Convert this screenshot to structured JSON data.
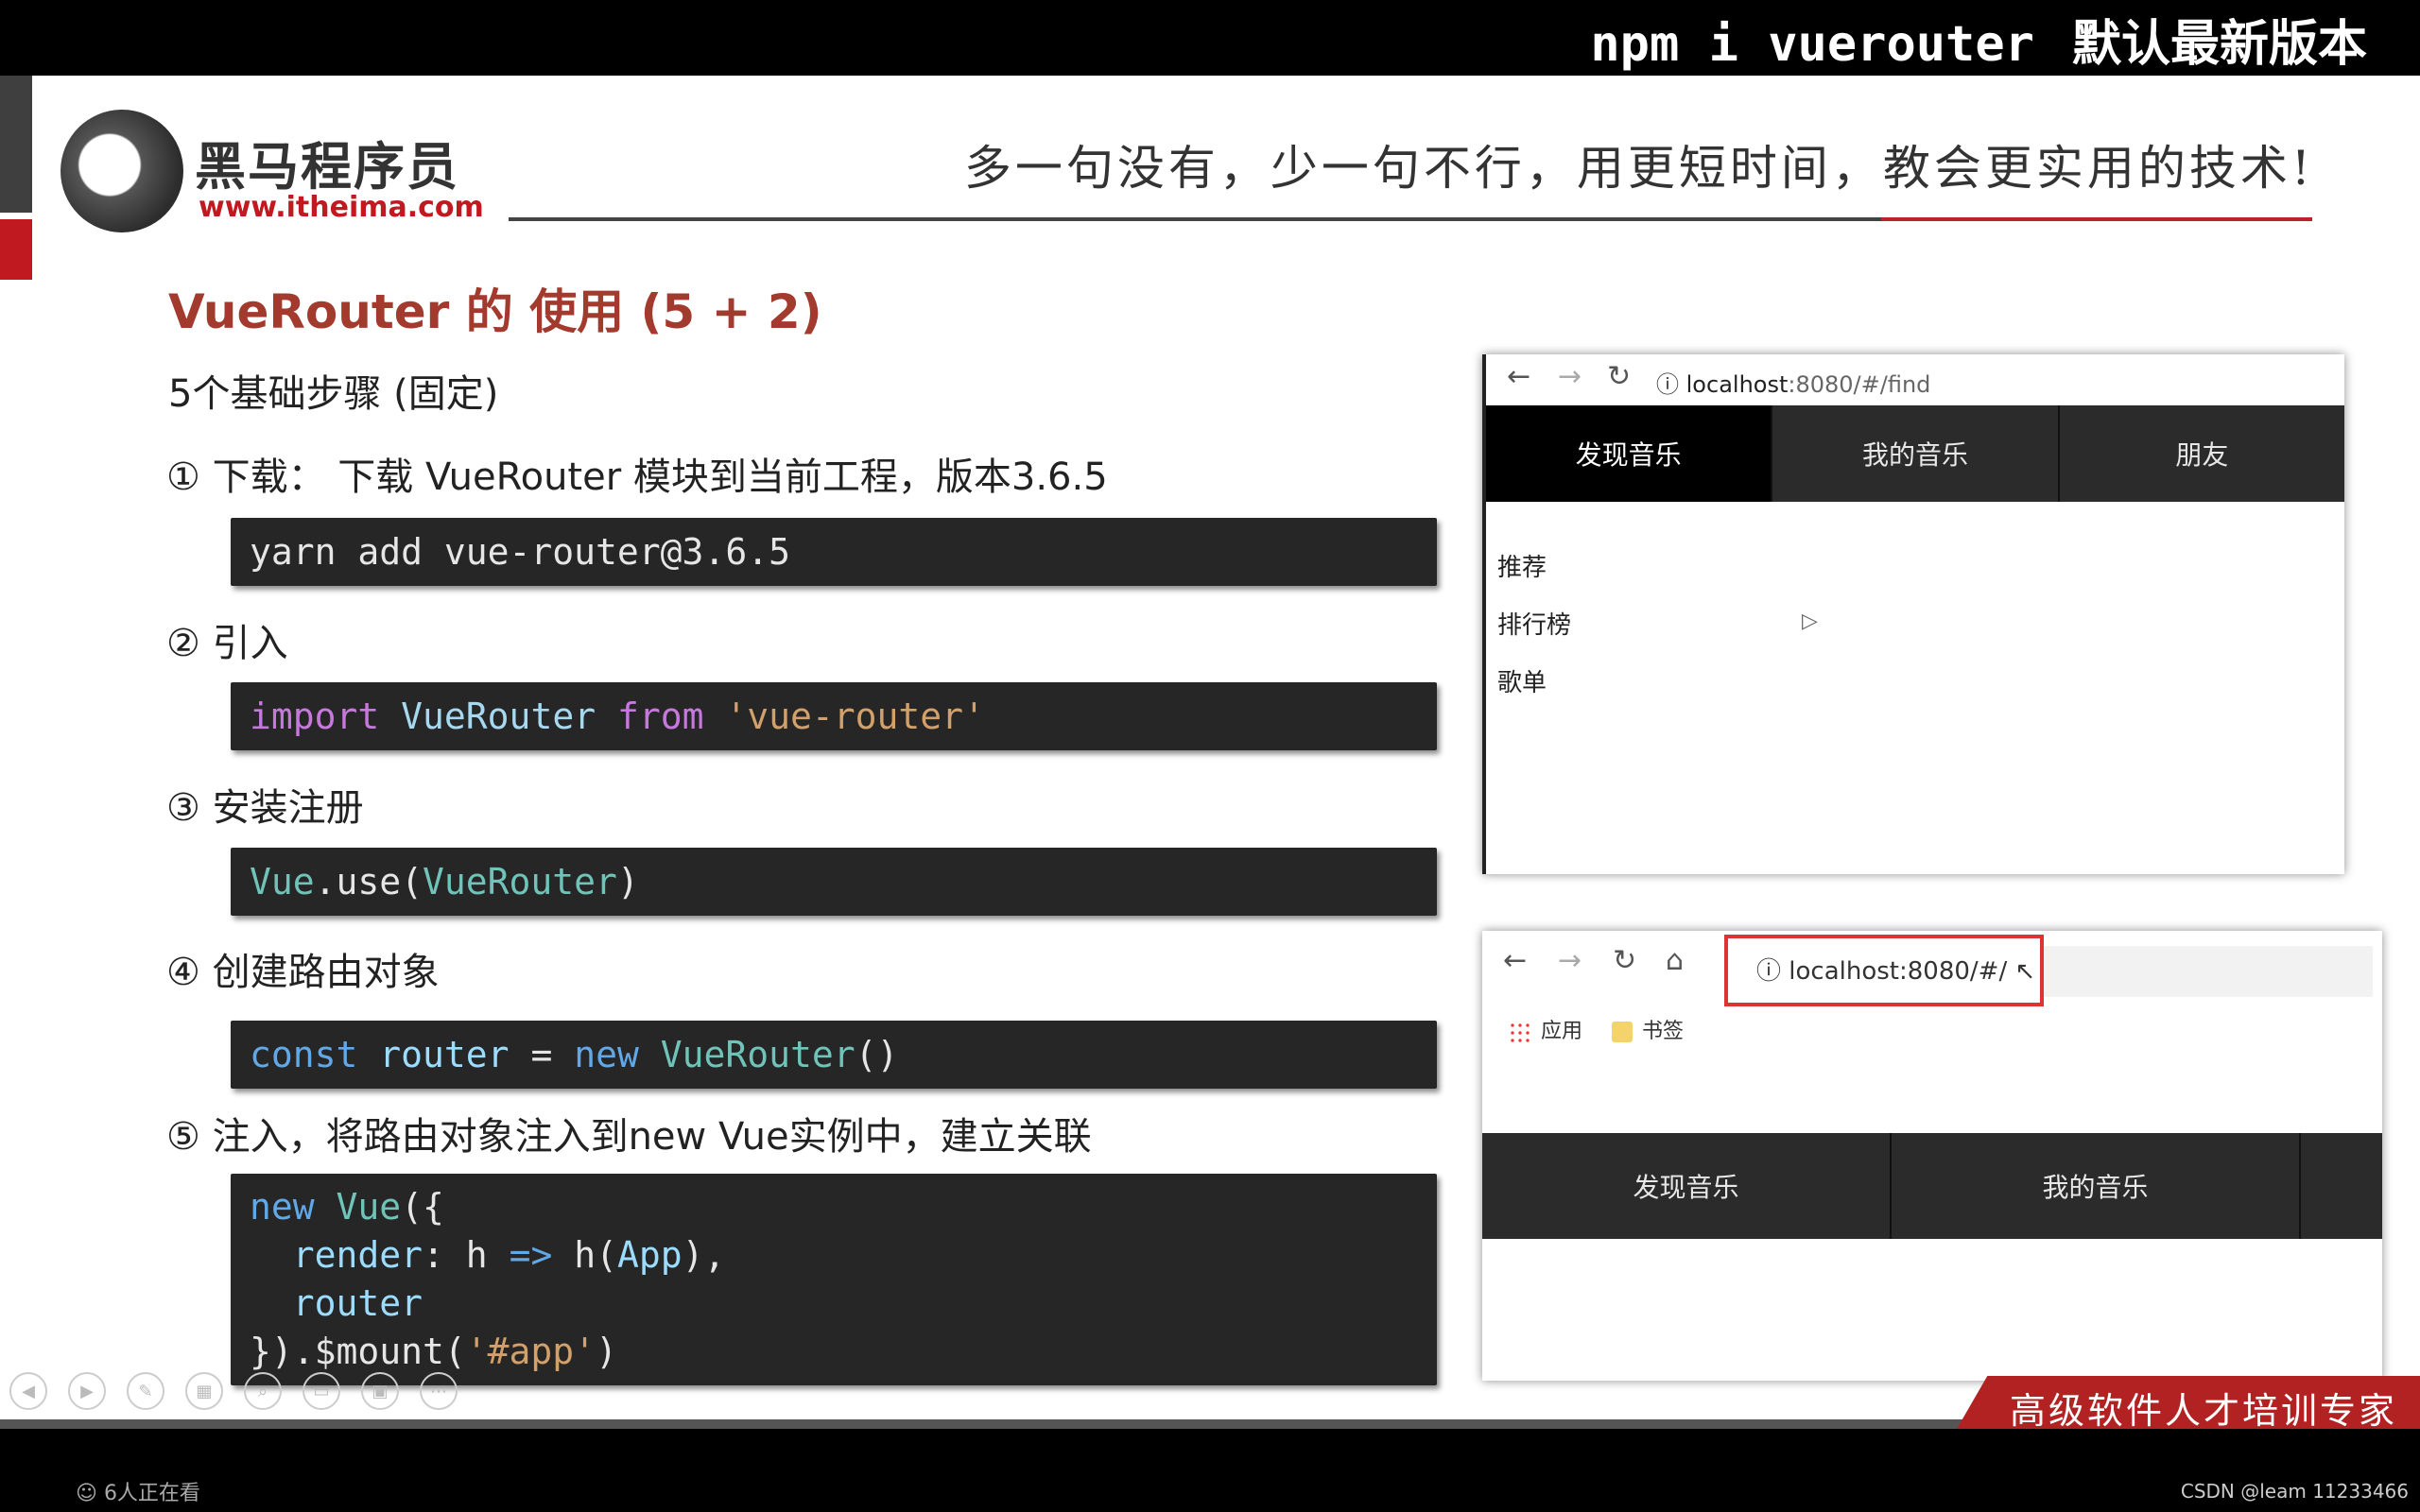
{
  "top_caption": {
    "cmd": "npm i vuerouter",
    "note": "默认最新版本"
  },
  "logo": {
    "name": "黑马程序员",
    "url": "www.itheima.com"
  },
  "slogan": "多一句没有，少一句不行，用更短时间，教会更实用的技术!",
  "slide": {
    "title": "VueRouter 的 使用 (5 + 2)",
    "subtitle": "5个基础步骤 (固定)",
    "steps": [
      {
        "label": "① 下载：  下载 VueRouter 模块到当前工程，版本3.6.5",
        "code": "yarn add vue-router@3.6.5"
      },
      {
        "label": "② 引入",
        "code": "import VueRouter from 'vue-router'"
      },
      {
        "label": "③ 安装注册",
        "code": "Vue.use(VueRouter)"
      },
      {
        "label": "④ 创建路由对象",
        "code": "const router = new VueRouter()"
      },
      {
        "label": "⑤ 注入，将路由对象注入到new Vue实例中，建立关联",
        "code": "new Vue({\n  render: h => h(App),\n  router\n}).$mount('#app')"
      }
    ]
  },
  "browser1": {
    "url_host": "localhost",
    "url_rest": ":8080/#/find",
    "tabs": [
      "发现音乐",
      "我的音乐",
      "朋友"
    ],
    "active_tab": "发现音乐",
    "list": [
      "推荐",
      "排行榜",
      "歌单"
    ]
  },
  "browser2": {
    "url": "localhost:8080/#/",
    "bookmarks": [
      "应用",
      "书签"
    ],
    "tabs": [
      "发现音乐",
      "我的音乐"
    ]
  },
  "footer_slogan": "高级软件人才培训专家",
  "viewers": "6人正在看",
  "watermark": "CSDN @leam 11233466",
  "icons": {
    "back": "arrow-left-icon",
    "forward": "arrow-right-icon",
    "reload": "reload-icon",
    "home": "home-icon",
    "info": "info-icon"
  }
}
